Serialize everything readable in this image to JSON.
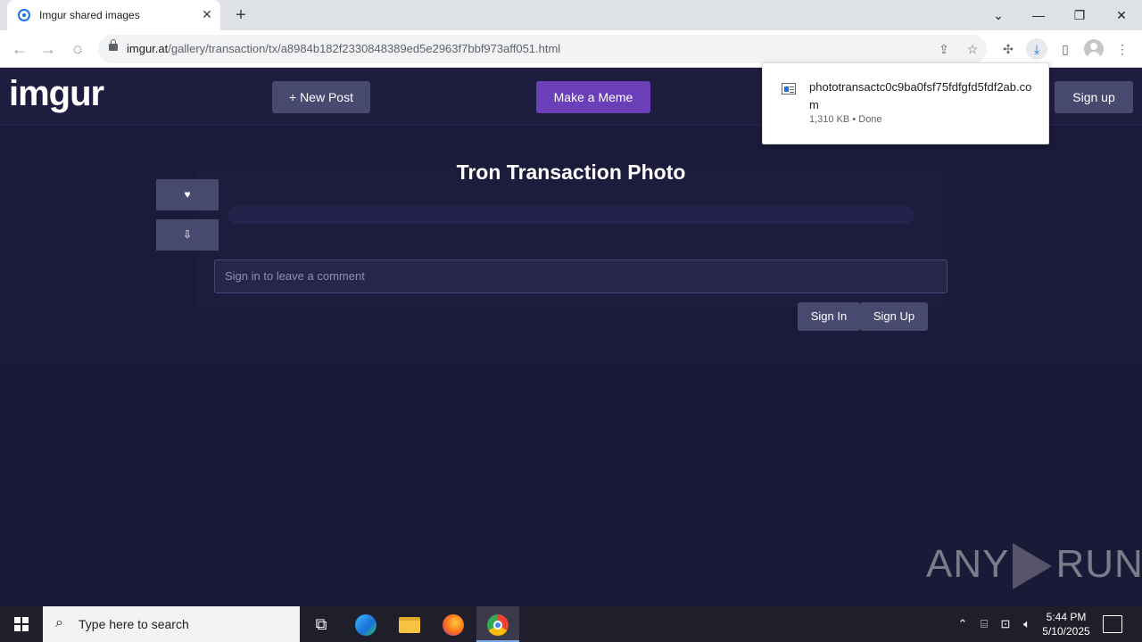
{
  "browser": {
    "tab_title": "Imgur shared images",
    "tab_close": "✕",
    "new_tab": "+",
    "url_host": "imgur.at",
    "url_path": "/gallery/transaction/tx/a8984b182f2330848389ed5e2963f7bbf973aff051.html",
    "icons": [
      "back-arrow-icon",
      "forward-arrow-icon",
      "stop-loading-icon",
      "lock-icon",
      "share-icon",
      "star-icon",
      "extensions-icon",
      "download-icon",
      "side-panel-icon",
      "profile-icon",
      "menu-icon"
    ]
  },
  "download": {
    "filename": "phototransactc0c9ba0fsf75fdfgfd5fdf2ab.com",
    "size": "1,310 KB",
    "separator": "•",
    "status": "Done"
  },
  "site": {
    "logo": "imgur",
    "new_post": "+ New Post",
    "make_meme": "Make a Meme",
    "sign_up": "Sign up",
    "post_title": "Tron Transaction Photo",
    "upvote": "♥",
    "download_btn": "⇩",
    "comment_placeholder": "Sign in to leave a comment",
    "sign_in": "Sign In",
    "sign_up_btn": "Sign Up"
  },
  "watermark": {
    "left": "ANY",
    "right": "RUN"
  },
  "taskbar": {
    "search_placeholder": "Type here to search",
    "time": "5:44 PM",
    "date": "5/10/2025"
  },
  "colors": {
    "page_bg": "#1b1a3a",
    "button_bg": "#474a6e",
    "meme_button": "#6a3fb8",
    "logo_dot": "#1bb76e"
  }
}
